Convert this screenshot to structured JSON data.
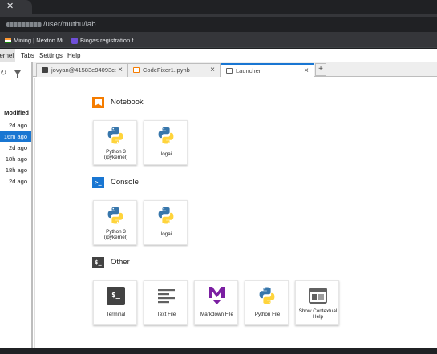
{
  "browser": {
    "url_visible": "/user/muthu/lab",
    "bookmarks": [
      "Mining | Nexton Mi...",
      "Biogas registration f..."
    ]
  },
  "menubar": {
    "items": [
      "Kernel",
      "Tabs",
      "Settings",
      "Help"
    ]
  },
  "file_browser": {
    "column_header": "Modified",
    "rows": [
      "2d ago",
      "16m ago",
      "2d ago",
      "18h ago",
      "18h ago",
      "2d ago"
    ]
  },
  "tabs": [
    {
      "label": "jovyan@41583e94093c: ~",
      "icon": "terminal-icon"
    },
    {
      "label": "CodeFixer1.ipynb",
      "icon": "notebook-icon"
    },
    {
      "label": "Launcher",
      "icon": "launcher-icon"
    }
  ],
  "new_tab_label": "+",
  "launcher": {
    "sections": {
      "notebook": {
        "title": "Notebook",
        "cards": [
          {
            "label_line1": "Python 3",
            "label_line2": "(ipykernel)"
          },
          {
            "label_line1": "logai",
            "label_line2": ""
          }
        ]
      },
      "console": {
        "title": "Console",
        "cards": [
          {
            "label_line1": "Python 3",
            "label_line2": "(ipykernel)"
          },
          {
            "label_line1": "logai",
            "label_line2": ""
          }
        ]
      },
      "other": {
        "title": "Other",
        "cards": [
          {
            "label_line1": "Terminal",
            "label_line2": "",
            "icon": "terminal-icon"
          },
          {
            "label_line1": "Text File",
            "label_line2": "",
            "icon": "text-file-icon"
          },
          {
            "label_line1": "Markdown File",
            "label_line2": "",
            "icon": "markdown-icon"
          },
          {
            "label_line1": "Python File",
            "label_line2": "",
            "icon": "python-icon"
          },
          {
            "label_line1": "Show Contextual",
            "label_line2": "Help",
            "icon": "contextual-help-icon"
          }
        ]
      }
    }
  },
  "colors": {
    "accent": "#1976d2",
    "notebook_orange": "#f57c00",
    "markdown_purple": "#7b1fa2",
    "python_blue": "#3776ab",
    "python_yellow": "#ffd43b"
  }
}
